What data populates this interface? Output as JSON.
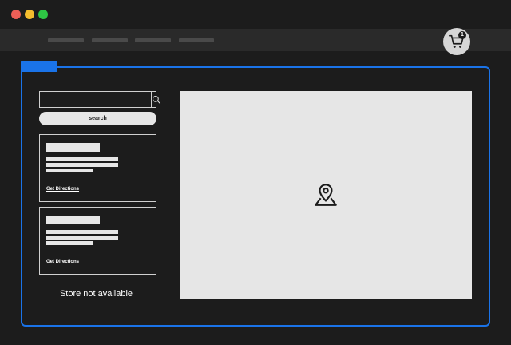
{
  "window": {
    "controls": [
      "close",
      "minimize",
      "maximize"
    ],
    "colors": {
      "close": "#ed5f57",
      "minimize": "#f5bd2e",
      "maximize": "#2ec644"
    }
  },
  "header": {
    "cart": {
      "icon": "cart-icon",
      "count": "1"
    }
  },
  "locator": {
    "search": {
      "value": "",
      "placeholder": "",
      "icon": "search-icon",
      "button_label": "search"
    },
    "stores": [
      {
        "directions_label": "Get Directions"
      },
      {
        "directions_label": "Get Directions"
      }
    ],
    "status_text": "Store not available",
    "map": {
      "icon": "map-pin-icon"
    }
  },
  "colors": {
    "accent": "#1a73e8",
    "background": "#1c1c1c",
    "placeholder_block": "#e6e6e6"
  }
}
